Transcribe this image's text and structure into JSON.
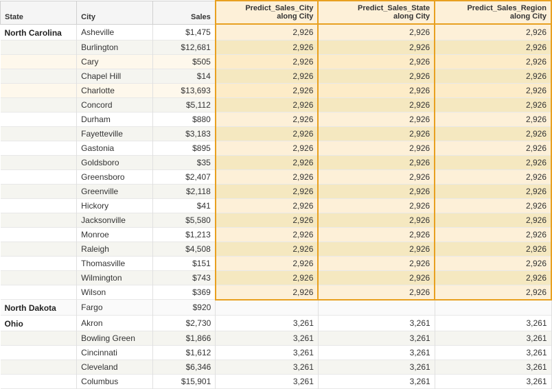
{
  "columns": {
    "state": "State",
    "city": "City",
    "sales": "Sales",
    "pred1": "Predict_Sales_City\nalong City",
    "pred2": "Predict_Sales_State\nalong City",
    "pred3": "Predict_Sales_Region\nalong City"
  },
  "rows": [
    {
      "state": "North Carolina",
      "city": "Asheville",
      "sales": "$1,475",
      "pred1": "2,926",
      "pred2": "2,926",
      "pred3": "2,926",
      "stateGroup": "nc",
      "alt": false
    },
    {
      "state": "",
      "city": "Burlington",
      "sales": "$12,681",
      "pred1": "2,926",
      "pred2": "2,926",
      "pred3": "2,926",
      "stateGroup": "nc",
      "alt": true
    },
    {
      "state": "",
      "city": "Cary",
      "sales": "$505",
      "pred1": "2,926",
      "pred2": "2,926",
      "pred3": "2,926",
      "stateGroup": "nc",
      "alt": false,
      "cary": true
    },
    {
      "state": "",
      "city": "Chapel Hill",
      "sales": "$14",
      "pred1": "2,926",
      "pred2": "2,926",
      "pred3": "2,926",
      "stateGroup": "nc",
      "alt": true
    },
    {
      "state": "",
      "city": "Charlotte",
      "sales": "$13,693",
      "pred1": "2,926",
      "pred2": "2,926",
      "pred3": "2,926",
      "stateGroup": "nc",
      "alt": false,
      "charlotte": true
    },
    {
      "state": "",
      "city": "Concord",
      "sales": "$5,112",
      "pred1": "2,926",
      "pred2": "2,926",
      "pred3": "2,926",
      "stateGroup": "nc",
      "alt": true
    },
    {
      "state": "",
      "city": "Durham",
      "sales": "$880",
      "pred1": "2,926",
      "pred2": "2,926",
      "pred3": "2,926",
      "stateGroup": "nc",
      "alt": false
    },
    {
      "state": "",
      "city": "Fayetteville",
      "sales": "$3,183",
      "pred1": "2,926",
      "pred2": "2,926",
      "pred3": "2,926",
      "stateGroup": "nc",
      "alt": true
    },
    {
      "state": "",
      "city": "Gastonia",
      "sales": "$895",
      "pred1": "2,926",
      "pred2": "2,926",
      "pred3": "2,926",
      "stateGroup": "nc",
      "alt": false
    },
    {
      "state": "",
      "city": "Goldsboro",
      "sales": "$35",
      "pred1": "2,926",
      "pred2": "2,926",
      "pred3": "2,926",
      "stateGroup": "nc",
      "alt": true
    },
    {
      "state": "",
      "city": "Greensboro",
      "sales": "$2,407",
      "pred1": "2,926",
      "pred2": "2,926",
      "pred3": "2,926",
      "stateGroup": "nc",
      "alt": false
    },
    {
      "state": "",
      "city": "Greenville",
      "sales": "$2,118",
      "pred1": "2,926",
      "pred2": "2,926",
      "pred3": "2,926",
      "stateGroup": "nc",
      "alt": true
    },
    {
      "state": "",
      "city": "Hickory",
      "sales": "$41",
      "pred1": "2,926",
      "pred2": "2,926",
      "pred3": "2,926",
      "stateGroup": "nc",
      "alt": false
    },
    {
      "state": "",
      "city": "Jacksonville",
      "sales": "$5,580",
      "pred1": "2,926",
      "pred2": "2,926",
      "pred3": "2,926",
      "stateGroup": "nc",
      "alt": true
    },
    {
      "state": "",
      "city": "Monroe",
      "sales": "$1,213",
      "pred1": "2,926",
      "pred2": "2,926",
      "pred3": "2,926",
      "stateGroup": "nc",
      "alt": false
    },
    {
      "state": "",
      "city": "Raleigh",
      "sales": "$4,508",
      "pred1": "2,926",
      "pred2": "2,926",
      "pred3": "2,926",
      "stateGroup": "nc",
      "alt": true
    },
    {
      "state": "",
      "city": "Thomasville",
      "sales": "$151",
      "pred1": "2,926",
      "pred2": "2,926",
      "pred3": "2,926",
      "stateGroup": "nc",
      "alt": false
    },
    {
      "state": "",
      "city": "Wilmington",
      "sales": "$743",
      "pred1": "2,926",
      "pred2": "2,926",
      "pred3": "2,926",
      "stateGroup": "nc",
      "alt": true
    },
    {
      "state": "",
      "city": "Wilson",
      "sales": "$369",
      "pred1": "2,926",
      "pred2": "2,926",
      "pred3": "2,926",
      "stateGroup": "nc",
      "alt": false,
      "last": true
    },
    {
      "state": "North Dakota",
      "city": "Fargo",
      "sales": "$920",
      "pred1": "",
      "pred2": "",
      "pred3": "",
      "stateGroup": "nd",
      "alt": false
    },
    {
      "state": "Ohio",
      "city": "Akron",
      "sales": "$2,730",
      "pred1": "3,261",
      "pred2": "3,261",
      "pred3": "3,261",
      "stateGroup": "oh",
      "alt": false
    },
    {
      "state": "",
      "city": "Bowling Green",
      "sales": "$1,866",
      "pred1": "3,261",
      "pred2": "3,261",
      "pred3": "3,261",
      "stateGroup": "oh",
      "alt": true
    },
    {
      "state": "",
      "city": "Cincinnati",
      "sales": "$1,612",
      "pred1": "3,261",
      "pred2": "3,261",
      "pred3": "3,261",
      "stateGroup": "oh",
      "alt": false
    },
    {
      "state": "",
      "city": "Cleveland",
      "sales": "$6,346",
      "pred1": "3,261",
      "pred2": "3,261",
      "pred3": "3,261",
      "stateGroup": "oh",
      "alt": true
    },
    {
      "state": "",
      "city": "Columbus",
      "sales": "$15,901",
      "pred1": "3,261",
      "pred2": "3,261",
      "pred3": "3,261",
      "stateGroup": "oh",
      "alt": false
    }
  ]
}
